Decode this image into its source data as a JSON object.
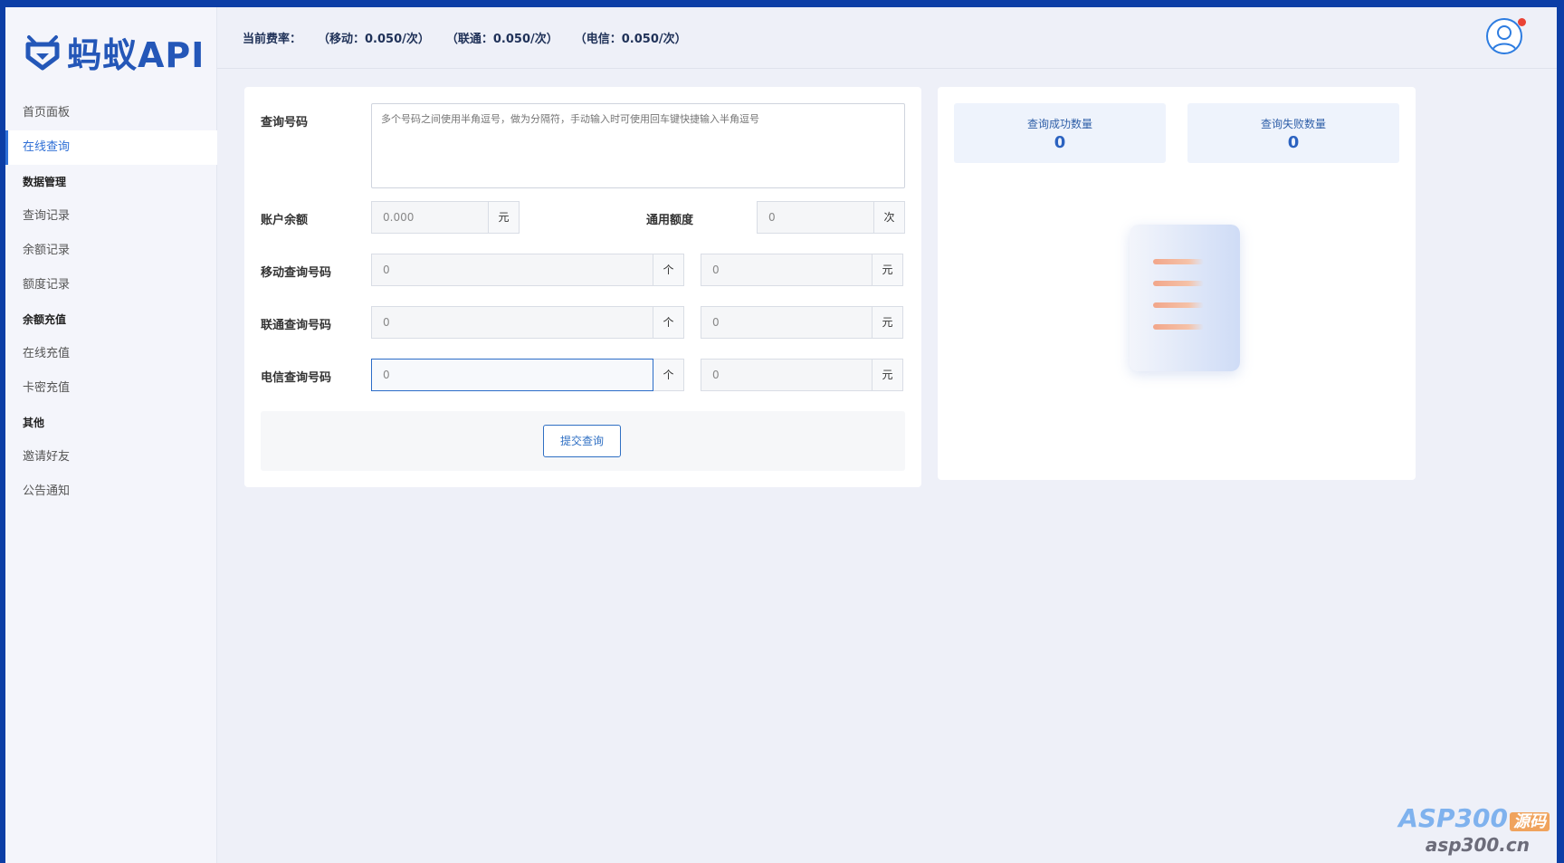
{
  "brand": {
    "name": "蚂蚁API"
  },
  "header": {
    "rate_label": "当前费率：",
    "rates": [
      "（移动：0.050/次）",
      "（联通：0.050/次）",
      "（电信：0.050/次）"
    ]
  },
  "sidebar": {
    "items": [
      {
        "type": "item",
        "label": "首页面板",
        "active": false
      },
      {
        "type": "item",
        "label": "在线查询",
        "active": true
      },
      {
        "type": "group",
        "label": "数据管理"
      },
      {
        "type": "item",
        "label": "查询记录",
        "active": false
      },
      {
        "type": "item",
        "label": "余额记录",
        "active": false
      },
      {
        "type": "item",
        "label": "额度记录",
        "active": false
      },
      {
        "type": "group",
        "label": "余额充值"
      },
      {
        "type": "item",
        "label": "在线充值",
        "active": false
      },
      {
        "type": "item",
        "label": "卡密充值",
        "active": false
      },
      {
        "type": "group",
        "label": "其他"
      },
      {
        "type": "item",
        "label": "邀请好友",
        "active": false
      },
      {
        "type": "item",
        "label": "公告通知",
        "active": false
      }
    ]
  },
  "form": {
    "query_label": "查询号码",
    "query_placeholder": "多个号码之间使用半角逗号，做为分隔符，手动输入时可使用回车键快捷输入半角逗号",
    "balance_label": "账户余额",
    "balance_value": "0.000",
    "balance_unit": "元",
    "quota_label": "通用额度",
    "quota_value": "0",
    "quota_unit": "次",
    "rows": [
      {
        "label": "移动查询号码",
        "count": "0",
        "count_unit": "个",
        "cost": "0",
        "cost_unit": "元"
      },
      {
        "label": "联通查询号码",
        "count": "0",
        "count_unit": "个",
        "cost": "0",
        "cost_unit": "元"
      },
      {
        "label": "电信查询号码",
        "count": "0",
        "count_unit": "个",
        "cost": "0",
        "cost_unit": "元"
      }
    ],
    "submit_label": "提交查询"
  },
  "stats": {
    "success_label": "查询成功数量",
    "success_value": "0",
    "fail_label": "查询失败数量",
    "fail_value": "0"
  },
  "watermark": {
    "top": "ASP300",
    "badge": "源码",
    "bottom": "asp300.cn"
  },
  "colors": {
    "accent": "#2f6fd6",
    "brand": "#2457b8",
    "frame": "#0c3ea6"
  }
}
